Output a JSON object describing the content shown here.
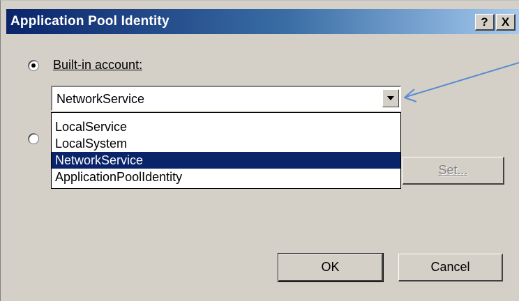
{
  "window": {
    "title": "Application Pool Identity",
    "help_button": "?",
    "close_button": "X"
  },
  "identity": {
    "builtin_label": "Built-in account:",
    "builtin_selected": true,
    "custom_selected": false,
    "combo_value": "NetworkService",
    "options": [
      "LocalService",
      "LocalSystem",
      "NetworkService",
      "ApplicationPoolIdentity"
    ],
    "highlighted_option": "NetworkService"
  },
  "buttons": {
    "set": "Set...",
    "ok": "OK",
    "cancel": "Cancel"
  },
  "colors": {
    "titlebar_start": "#0a246a",
    "titlebar_end": "#a6caf0",
    "dialog_bg": "#d4d0c8",
    "selection_bg": "#0a246a",
    "annotation_arrow": "#5b8bd0"
  },
  "annotation": {
    "icon": "pointer-arrow"
  }
}
